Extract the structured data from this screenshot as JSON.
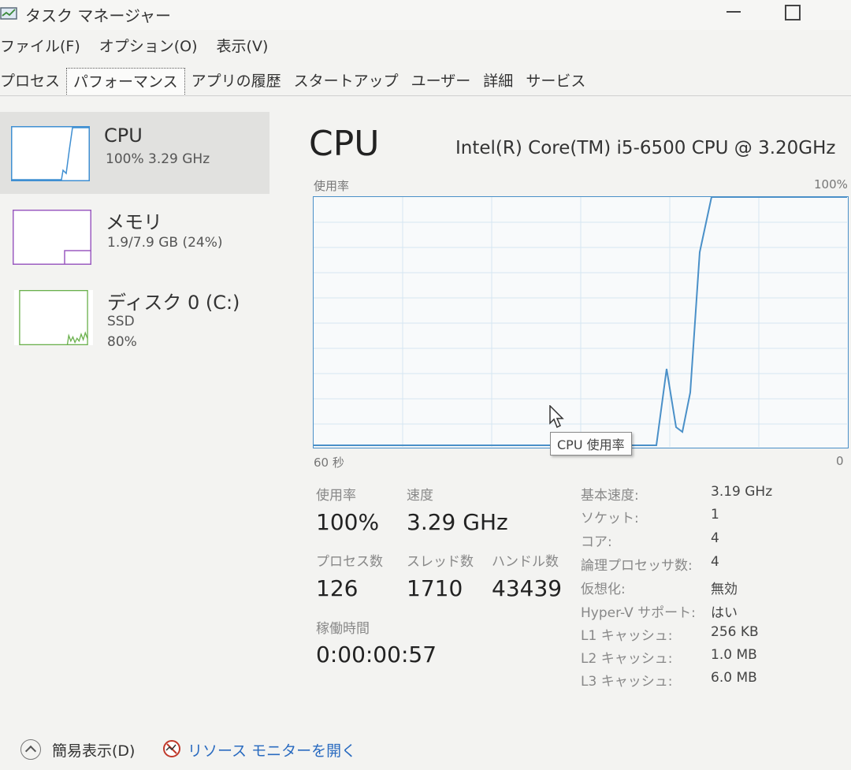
{
  "window": {
    "title": "タスク マネージャー"
  },
  "menu": [
    "ファイル(F)",
    "オプション(O)",
    "表示(V)"
  ],
  "tabs": [
    "プロセス",
    "パフォーマンス",
    "アプリの履歴",
    "スタートアップ",
    "ユーザー",
    "詳細",
    "サービス"
  ],
  "active_tab": "パフォーマンス",
  "sidebar": {
    "items": [
      {
        "name": "CPU",
        "line1": "100%  3.29 GHz",
        "line2": "",
        "color": "#3f8fd2",
        "selected": true
      },
      {
        "name": "メモリ",
        "line1": "1.9/7.9 GB (24%)",
        "line2": "",
        "color": "#9b5cc0",
        "selected": false
      },
      {
        "name": "ディスク 0 (C:)",
        "line1": "SSD",
        "line2": "80%",
        "color": "#6ab04c",
        "selected": false
      }
    ]
  },
  "main": {
    "title": "CPU",
    "model": "Intel(R) Core(TM) i5-6500 CPU @ 3.20GHz",
    "graph": {
      "y_label": "使用率",
      "y_max_label": "100%",
      "x_left_label": "60 秒",
      "x_right_label": "0",
      "tooltip": "CPU 使用率",
      "line_color": "#4a90c8"
    },
    "stats": {
      "usage_label": "使用率",
      "usage_value": "100%",
      "speed_label": "速度",
      "speed_value": "3.29 GHz",
      "processes_label": "プロセス数",
      "processes_value": "126",
      "threads_label": "スレッド数",
      "threads_value": "1710",
      "handles_label": "ハンドル数",
      "handles_value": "43439",
      "uptime_label": "稼働時間",
      "uptime_value": "0:00:00:57"
    },
    "specs": [
      {
        "label": "基本速度:",
        "value": "3.19 GHz"
      },
      {
        "label": "ソケット:",
        "value": "1"
      },
      {
        "label": "コア:",
        "value": "4"
      },
      {
        "label": "論理プロセッサ数:",
        "value": "4"
      },
      {
        "label": "仮想化:",
        "value": "無効"
      },
      {
        "label": "Hyper-V サポート:",
        "value": "はい"
      },
      {
        "label": "L1 キャッシュ:",
        "value": "256 KB"
      },
      {
        "label": "L2 キャッシュ:",
        "value": "1.0 MB"
      },
      {
        "label": "L3 キャッシュ:",
        "value": "6.0 MB"
      }
    ]
  },
  "footer": {
    "fewer_details": "簡易表示(D)",
    "resource_monitor": "リソース モニターを開く"
  }
}
